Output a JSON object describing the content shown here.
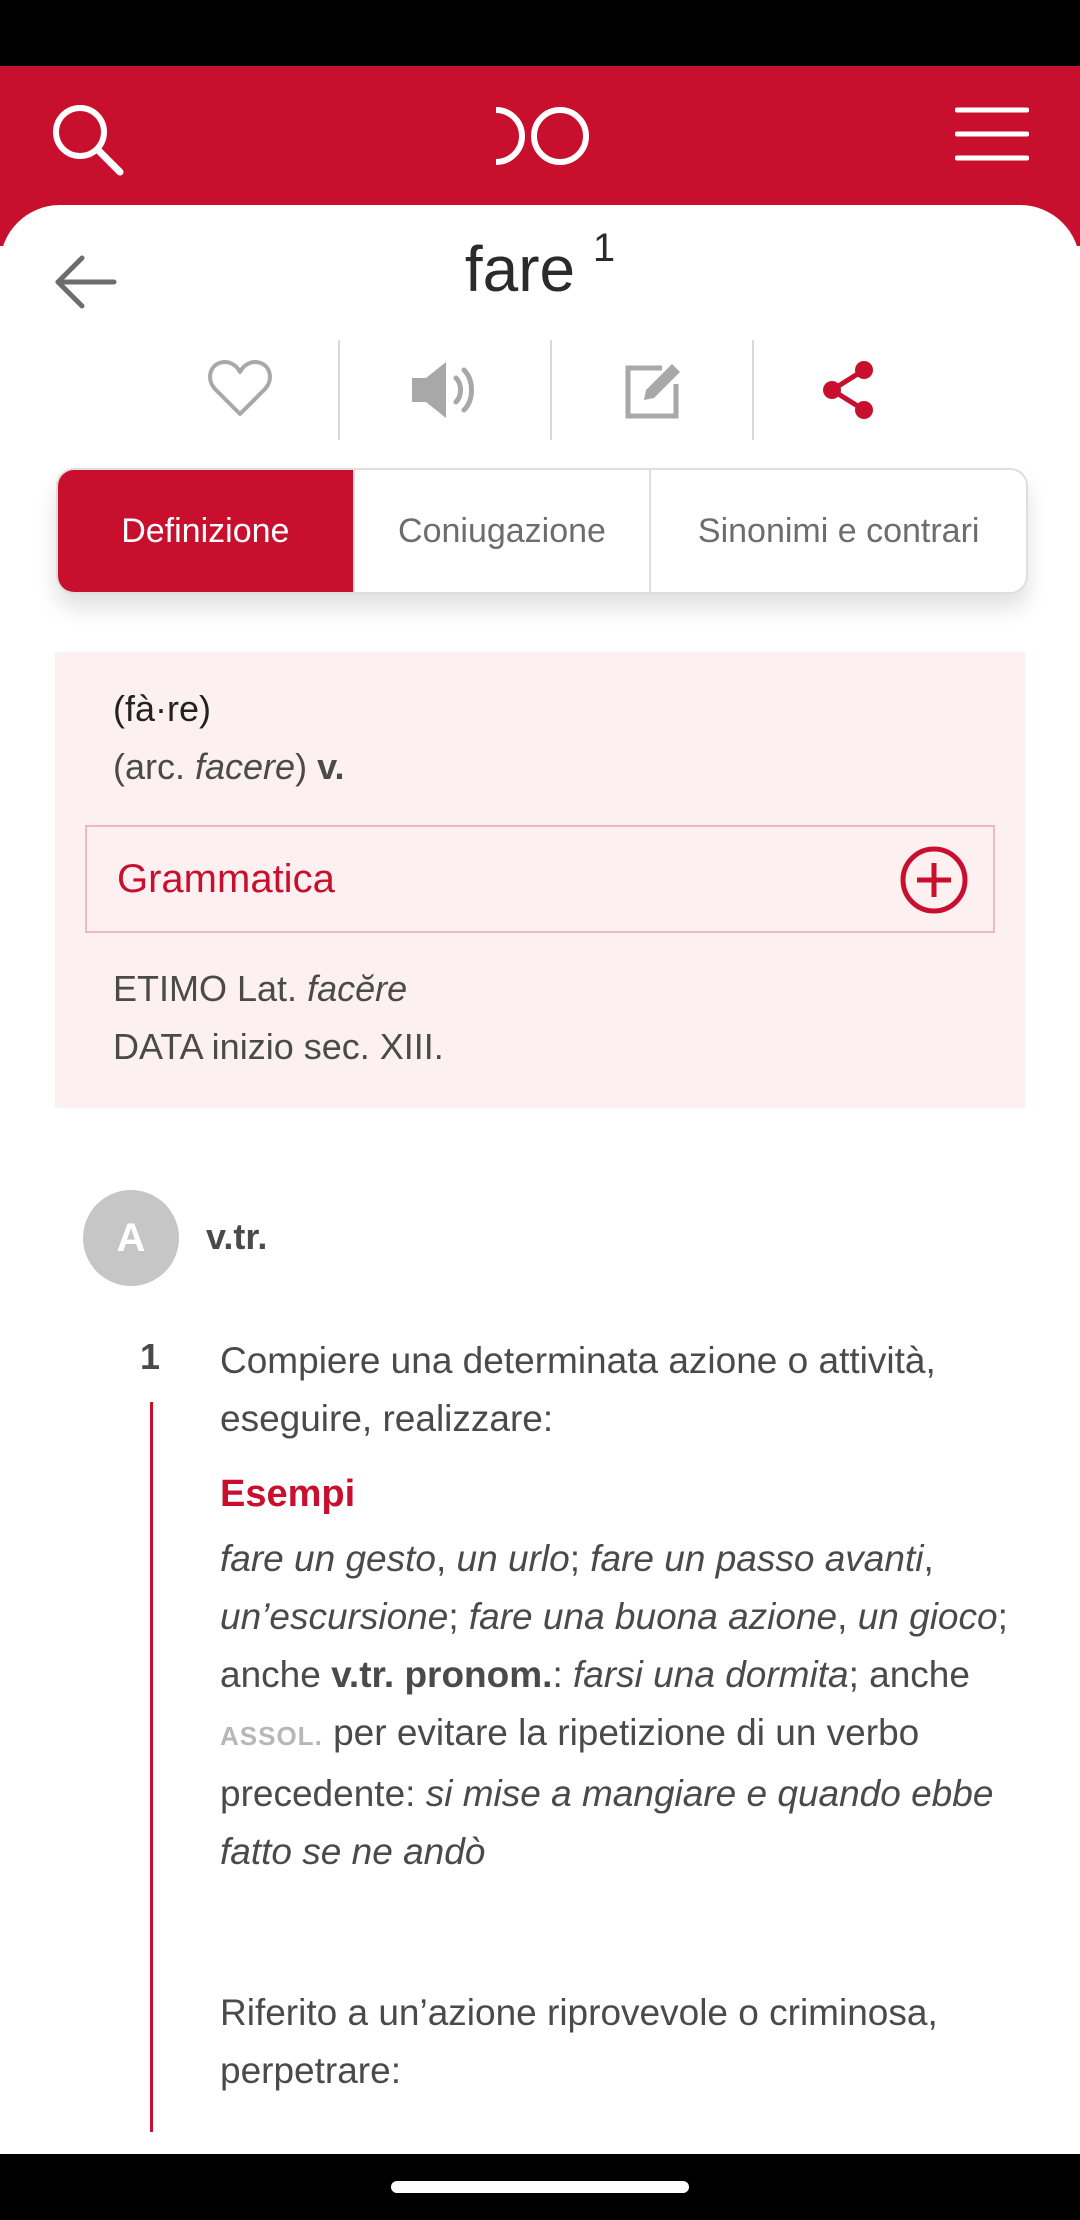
{
  "header": {
    "brand_color": "#c8102e",
    "logo_icon": "double-circle-logo-icon",
    "search_icon": "search-icon",
    "menu_icon": "hamburger-menu-icon"
  },
  "entry": {
    "word": "fare",
    "superscript": "1"
  },
  "actions": {
    "icons": [
      "heart-icon",
      "speaker-icon",
      "edit-icon",
      "share-icon"
    ]
  },
  "tabs": [
    {
      "label": "Definizione",
      "active": true
    },
    {
      "label": "Coniugazione",
      "active": false
    },
    {
      "label": "Sinonimi e contrari",
      "active": false
    }
  ],
  "info": {
    "pronunciation": "(fà·re)",
    "arc_prefix": "(arc. ",
    "arc_word": "facere",
    "arc_suffix": ")",
    "pos": "v.",
    "grammatica_label": "Grammatica",
    "etimo_label": "ETIMO Lat.",
    "etimo_word": "facĕre",
    "data_text": "DATA inizio sec. XIII."
  },
  "section": {
    "badge": "A",
    "label": "v.tr."
  },
  "definition": {
    "number": "1",
    "text": "Compiere una determinata azione o attività, eseguire, realizzare:",
    "examples_label": "Esempi",
    "ex1": "fare un gesto",
    "ex2": "un urlo",
    "ex3": "fare un passo avanti",
    "ex4": "un’escursione",
    "ex5": "fare una buona azione",
    "ex6": "un gioco",
    "anche1": "; anche ",
    "pronom": "v.tr. pronom.",
    "ex7": "farsi una dormita",
    "anche2": "; anche ",
    "assol": "ASSOL.",
    "per_text": " per evitare la ripetizione di un verbo precedente: ",
    "ex8": "si mise a mangiare e quando ebbe fatto se ne andò",
    "text2": "Riferito a un’azione riprovevole o criminosa, perpetrare:"
  }
}
